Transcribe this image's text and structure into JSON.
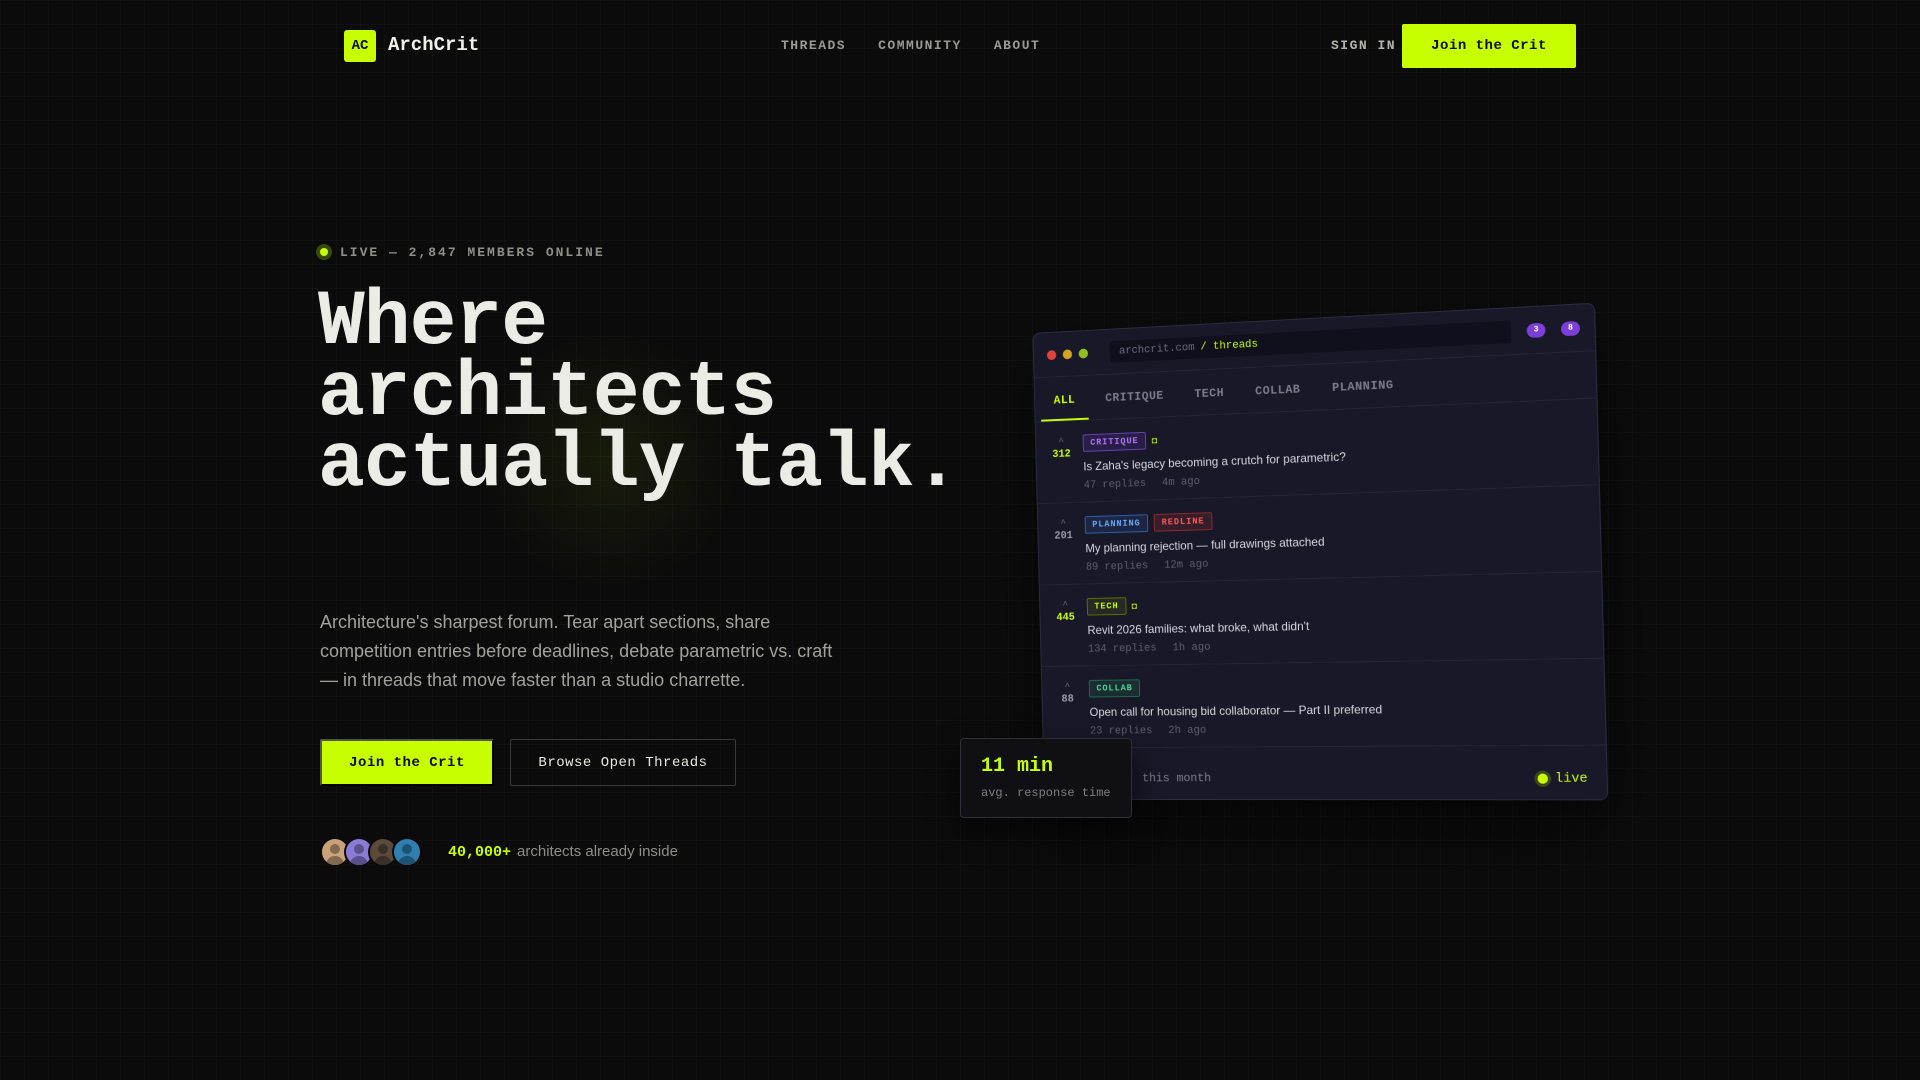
{
  "brand": {
    "mark": "AC",
    "name": "ArchCrit"
  },
  "nav": {
    "links": [
      "THREADS",
      "COMMUNITY",
      "ABOUT"
    ],
    "sign_in": "SIGN IN",
    "cta": "Join the Crit"
  },
  "hero": {
    "live_label": "LIVE — 2,847 MEMBERS ONLINE",
    "headline": [
      "Where",
      "architects",
      "actually talk."
    ],
    "lede": "Architecture's sharpest forum. Tear apart sections, share competition entries before deadlines, debate parametric vs. craft — in threads that move faster than a studio charrette.",
    "primary_cta": "Join the Crit",
    "secondary_cta": "Browse Open Threads",
    "member_count": "40,000+",
    "member_caption": "architects already inside",
    "avatar_colors": [
      "#c9a27a",
      "#8a7bd6",
      "#5a4a3c",
      "#2f7fb0"
    ]
  },
  "mock": {
    "url_domain": "archcrit.com",
    "url_path": "/ threads",
    "notif_counts": [
      "3",
      "8"
    ],
    "tabs": [
      "ALL",
      "CRITIQUE",
      "TECH",
      "COLLAB",
      "PLANNING"
    ],
    "active_tab": "ALL",
    "threads": [
      {
        "votes": "312",
        "hot": true,
        "tags": [
          "CRITIQUE"
        ],
        "title": "Is Zaha's legacy becoming a crutch for parametric?",
        "replies": "47 replies",
        "age": "4m ago"
      },
      {
        "votes": "201",
        "hot": false,
        "tags": [
          "PLANNING",
          "REDLINE"
        ],
        "title": "My planning rejection — full drawings attached",
        "replies": "89 replies",
        "age": "12m ago"
      },
      {
        "votes": "445",
        "hot": true,
        "tags": [
          "TECH"
        ],
        "title": "Revit 2026 families: what broke, what didn't",
        "replies": "134 replies",
        "age": "1h ago"
      },
      {
        "votes": "88",
        "hot": false,
        "tags": [
          "COLLAB"
        ],
        "title": "Open call for housing bid collaborator — Part II preferred",
        "replies": "23 replies",
        "age": "2h ago"
      }
    ],
    "footer_month": "this month",
    "footer_live": "live"
  },
  "stat": {
    "value": "11 min",
    "label": "avg. response time"
  },
  "colors": {
    "accent": "#c8ff00",
    "background": "#0b0b0b",
    "panel": "#181828"
  }
}
